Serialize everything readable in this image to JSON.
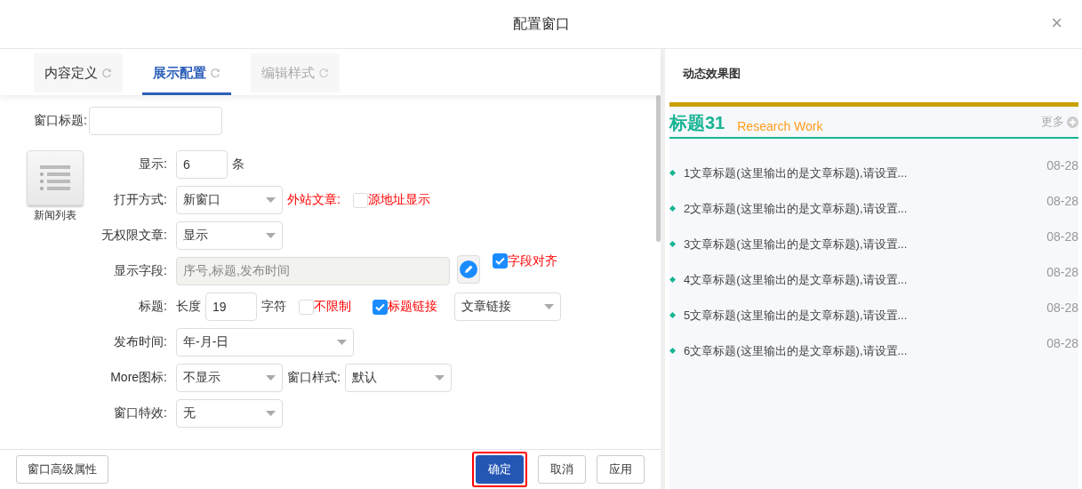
{
  "window": {
    "title": "配置窗口",
    "close": "×"
  },
  "tabs": [
    {
      "label": "内容定义",
      "selected": false,
      "disabled": false
    },
    {
      "label": "展示配置",
      "selected": true,
      "disabled": false
    },
    {
      "label": "编辑样式",
      "selected": false,
      "disabled": true
    }
  ],
  "form": {
    "title_label": "窗口标题:",
    "layout_caption": "新闻列表",
    "rows": [
      {
        "label": "显示:",
        "items": [
          {
            "kind": "input",
            "value": "6"
          },
          {
            "kind": "text",
            "text": "条"
          }
        ]
      },
      {
        "label": "打开方式:",
        "items": [
          {
            "kind": "select",
            "value": "新窗口"
          },
          {
            "kind": "note",
            "text": "外站文章:"
          },
          {
            "kind": "checkbox",
            "checked": false,
            "text": "源地址显示"
          }
        ]
      },
      {
        "label": "无权限文章:",
        "items": [
          {
            "kind": "select",
            "value": "显示"
          }
        ]
      },
      {
        "label": "显示字段:",
        "items": [
          {
            "kind": "readonly",
            "value": "序号,标题,发布时间"
          },
          {
            "kind": "edit"
          },
          {
            "kind": "checkbox",
            "checked": true,
            "text": "字段对齐"
          }
        ]
      },
      {
        "label": "标题:",
        "items": [
          {
            "kind": "text",
            "text": "长度"
          },
          {
            "kind": "input",
            "value": "19"
          },
          {
            "kind": "text",
            "text": "字符"
          },
          {
            "kind": "checkbox",
            "checked": false,
            "text": "不限制"
          },
          {
            "kind": "checkbox",
            "checked": true,
            "text": "标题链接"
          },
          {
            "kind": "select",
            "value": "文章链接"
          }
        ]
      },
      {
        "label": "发布时间:",
        "items": [
          {
            "kind": "select",
            "value": "年-月-日"
          }
        ]
      },
      {
        "label": "More图标:",
        "items": [
          {
            "kind": "select",
            "value": "不显示"
          },
          {
            "kind": "text",
            "text": "窗口样式:"
          },
          {
            "kind": "select",
            "value": "默认"
          }
        ]
      },
      {
        "label": "窗口特效:",
        "items": [
          {
            "kind": "select",
            "value": "无"
          }
        ]
      }
    ]
  },
  "preview": {
    "header": "动态效果图",
    "title": "标题31",
    "subtitle": "Research Work",
    "more": "更多",
    "items": [
      {
        "title": "1文章标题(这里输出的是文章标题),请设置...",
        "date": "08-28"
      },
      {
        "title": "2文章标题(这里输出的是文章标题),请设置...",
        "date": "08-28"
      },
      {
        "title": "3文章标题(这里输出的是文章标题),请设置...",
        "date": "08-28"
      },
      {
        "title": "4文章标题(这里输出的是文章标题),请设置...",
        "date": "08-28"
      },
      {
        "title": "5文章标题(这里输出的是文章标题),请设置...",
        "date": "08-28"
      },
      {
        "title": "6文章标题(这里输出的是文章标题),请设置...",
        "date": "08-28"
      }
    ]
  },
  "footer": {
    "advanced": "窗口高级属性",
    "buttons": [
      {
        "label": "确定",
        "kind": "primary",
        "highlighted": true
      },
      {
        "label": "取消",
        "kind": "default",
        "highlighted": false
      },
      {
        "label": "应用",
        "kind": "default",
        "highlighted": false
      }
    ]
  }
}
